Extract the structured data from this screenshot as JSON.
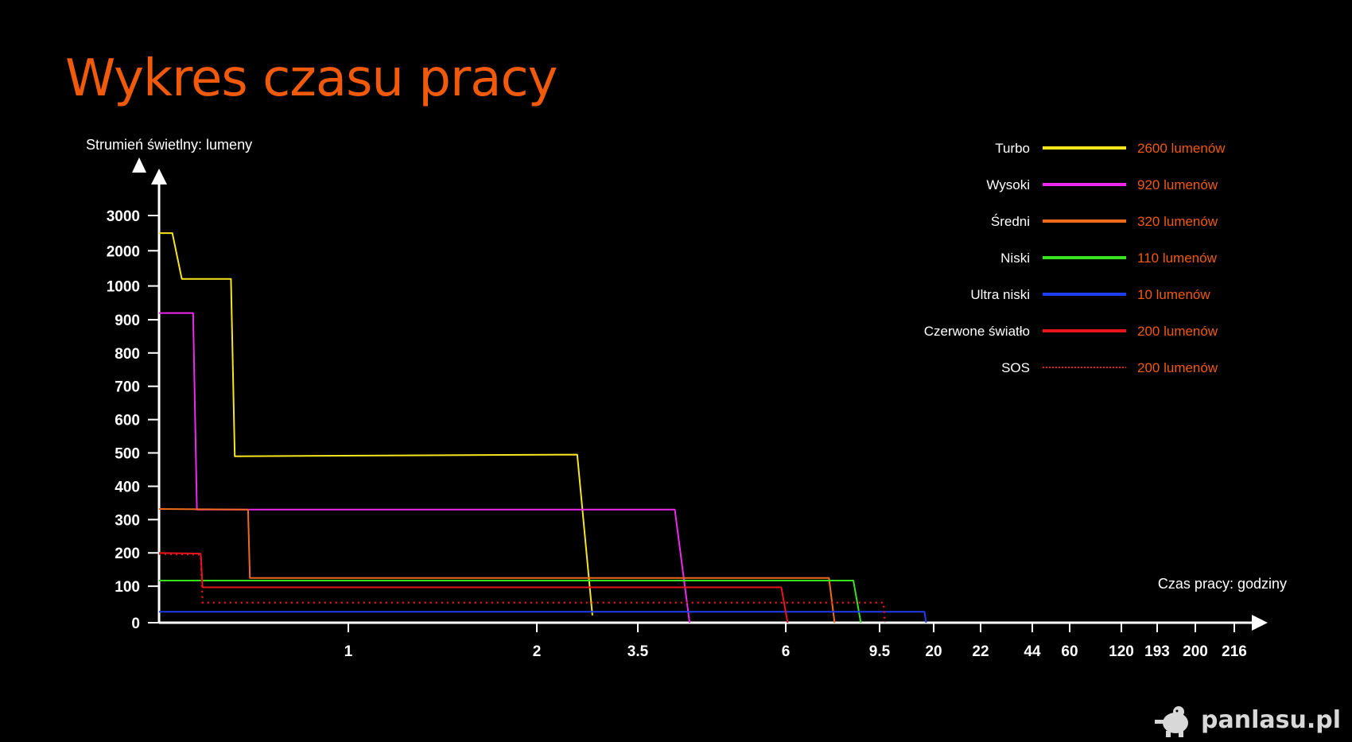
{
  "title": "Wykres czasu pracy",
  "watermark": "panlasu.pl",
  "chart_data": {
    "type": "line",
    "ylabel": "Strumień świetlny: lumeny",
    "xlabel": "Czas pracy: godziny",
    "y_ticks": [
      {
        "label": "3000",
        "frac": 0.0
      },
      {
        "label": "2000",
        "frac": 0.0865
      },
      {
        "label": "1000",
        "frac": 0.173
      },
      {
        "label": "900",
        "frac": 0.256
      },
      {
        "label": "800",
        "frac": 0.3375
      },
      {
        "label": "700",
        "frac": 0.4194
      },
      {
        "label": "600",
        "frac": 0.5012
      },
      {
        "label": "500",
        "frac": 0.583
      },
      {
        "label": "400",
        "frac": 0.665
      },
      {
        "label": "300",
        "frac": 0.7468
      },
      {
        "label": "200",
        "frac": 0.8286
      },
      {
        "label": "100",
        "frac": 0.9104
      },
      {
        "label": "0",
        "frac": 1.0
      }
    ],
    "x_ticks": [
      "1",
      "2",
      "3.5",
      "6",
      "9.5",
      "20",
      "22",
      "44",
      "60",
      "120",
      "193",
      "200",
      "216"
    ],
    "series": [
      {
        "name": "Turbo",
        "value_label": "2600 lumenów",
        "color": "#f7e51e",
        "dash": false,
        "points": [
          [
            0,
            2500
          ],
          [
            0.07,
            2500
          ],
          [
            0.12,
            1200
          ],
          [
            0.38,
            1200
          ],
          [
            0.4,
            490
          ],
          [
            2.4,
            495
          ],
          [
            2.55,
            20
          ]
        ]
      },
      {
        "name": "Wysoki",
        "value_label": "920 lumenów",
        "color": "#ee28ee",
        "dash": false,
        "points": [
          [
            0,
            920
          ],
          [
            0.18,
            920
          ],
          [
            0.2,
            330
          ],
          [
            3.25,
            330
          ],
          [
            3.35,
            0
          ]
        ]
      },
      {
        "name": "Średni",
        "value_label": "320 lumenów",
        "color": "#f06a1e",
        "dash": false,
        "points": [
          [
            0,
            332
          ],
          [
            0.47,
            330
          ],
          [
            0.48,
            125
          ],
          [
            4.46,
            125
          ],
          [
            4.52,
            0
          ]
        ]
      },
      {
        "name": "Niski",
        "value_label": "110 lumenów",
        "color": "#39e21e",
        "dash": false,
        "points": [
          [
            0,
            117
          ],
          [
            4.72,
            117
          ],
          [
            4.8,
            0
          ]
        ]
      },
      {
        "name": "Ultra niski",
        "value_label": "10 lumenów",
        "color": "#1e3cf0",
        "dash": false,
        "points": [
          [
            0,
            30
          ],
          [
            5.83,
            30
          ],
          [
            5.86,
            0
          ]
        ]
      },
      {
        "name": "Czerwone światło",
        "value_label": "200 lumenów",
        "color": "#e8141e",
        "dash": false,
        "points": [
          [
            0,
            200
          ],
          [
            0.22,
            198
          ],
          [
            0.23,
            97
          ],
          [
            3.97,
            97
          ],
          [
            4.02,
            0
          ]
        ]
      },
      {
        "name": "SOS",
        "value_label": "200 lumenów",
        "color": "#e8141e",
        "dash": true,
        "points": [
          [
            0,
            197
          ],
          [
            0.22,
            195
          ],
          [
            0.23,
            55
          ],
          [
            5.07,
            55
          ],
          [
            5.1,
            0
          ]
        ]
      }
    ]
  }
}
